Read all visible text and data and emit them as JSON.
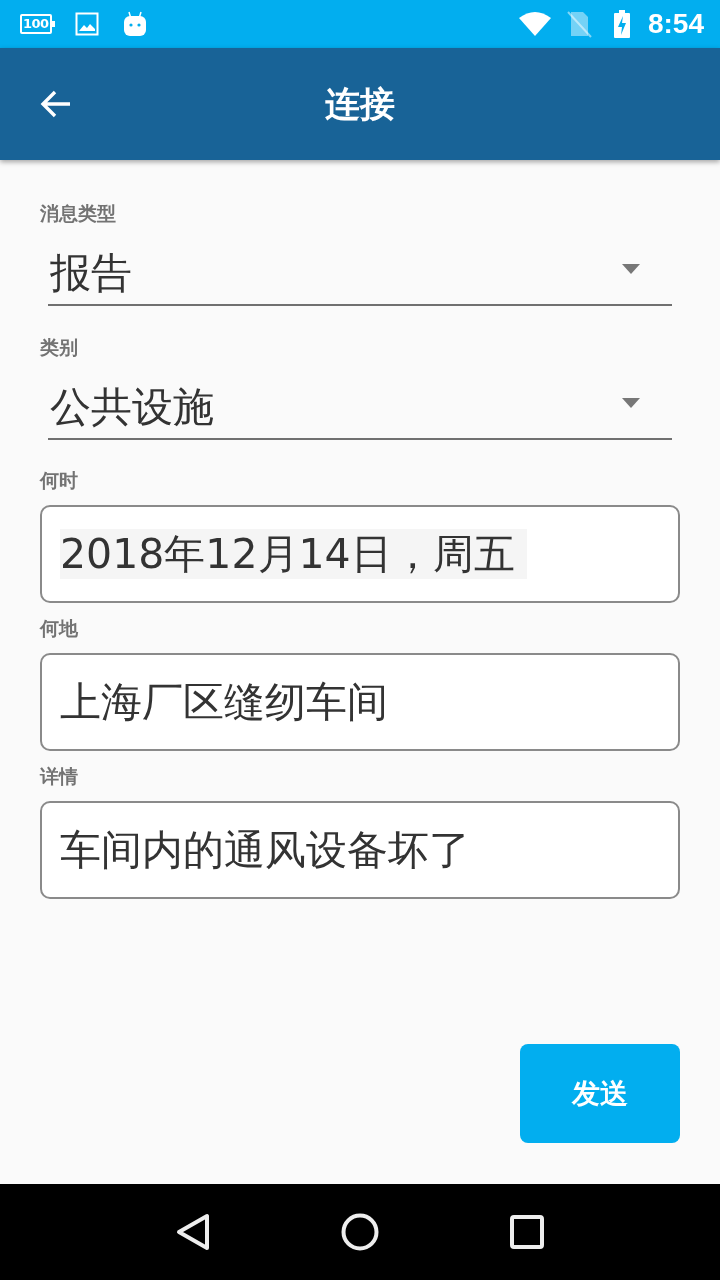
{
  "status_bar": {
    "battery_notification": "100",
    "time": "8:54"
  },
  "app_bar": {
    "title": "连接"
  },
  "form": {
    "fields": [
      {
        "kind": "dropdown",
        "label": "消息类型",
        "value": "报告"
      },
      {
        "kind": "dropdown",
        "label": "类别",
        "value": "公共设施"
      },
      {
        "kind": "date",
        "label": "何时",
        "value": "2018年12月14日，周五"
      },
      {
        "kind": "text",
        "label": "何地",
        "value": "上海厂区缝纫车间"
      },
      {
        "kind": "text",
        "label": "详情",
        "value": "车间内的通风设备坏了"
      }
    ]
  },
  "send_button": {
    "label": "发送"
  }
}
